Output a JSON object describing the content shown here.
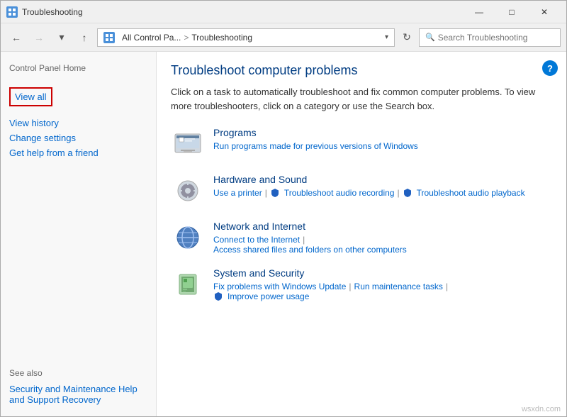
{
  "window": {
    "title": "Troubleshooting",
    "controls": {
      "minimize": "—",
      "maximize": "□",
      "close": "✕"
    }
  },
  "address_bar": {
    "back": "←",
    "forward": "→",
    "up": "↑",
    "crumb1": "All Control Pa...",
    "separator": ">",
    "current": "Troubleshooting",
    "refresh": "↻",
    "search_placeholder": "Search Troubleshooting"
  },
  "sidebar": {
    "control_panel_home": "Control Panel Home",
    "view_all": "View all",
    "view_history": "View history",
    "change_settings": "Change settings",
    "get_help": "Get help from a friend",
    "see_also": "See also",
    "security_maintenance": "Security and Maintenance",
    "help_support": "Help and Support",
    "recovery": "Recovery"
  },
  "content": {
    "title": "Troubleshoot computer problems",
    "description": "Click on a task to automatically troubleshoot and fix common computer problems. To view more troubleshooters, click on a category or use the Search box.",
    "help_btn": "?",
    "categories": [
      {
        "id": "programs",
        "title": "Programs",
        "links": [
          {
            "text": "Run programs made for previous versions of Windows",
            "has_shield": false
          }
        ]
      },
      {
        "id": "hardware-sound",
        "title": "Hardware and Sound",
        "links": [
          {
            "text": "Use a printer",
            "has_shield": false
          },
          {
            "text": "Troubleshoot audio recording",
            "has_shield": true
          },
          {
            "text": "Troubleshoot audio playback",
            "has_shield": true
          }
        ]
      },
      {
        "id": "network-internet",
        "title": "Network and Internet",
        "links": [
          {
            "text": "Connect to the Internet",
            "has_shield": false
          },
          {
            "text": "Access shared files and folders on other computers",
            "has_shield": false
          }
        ]
      },
      {
        "id": "system-security",
        "title": "System and Security",
        "links": [
          {
            "text": "Fix problems with Windows Update",
            "has_shield": false
          },
          {
            "text": "Run maintenance tasks",
            "has_shield": false
          },
          {
            "text": "Improve power usage",
            "has_shield": true
          }
        ]
      }
    ]
  },
  "watermark": "wsxdn.com"
}
